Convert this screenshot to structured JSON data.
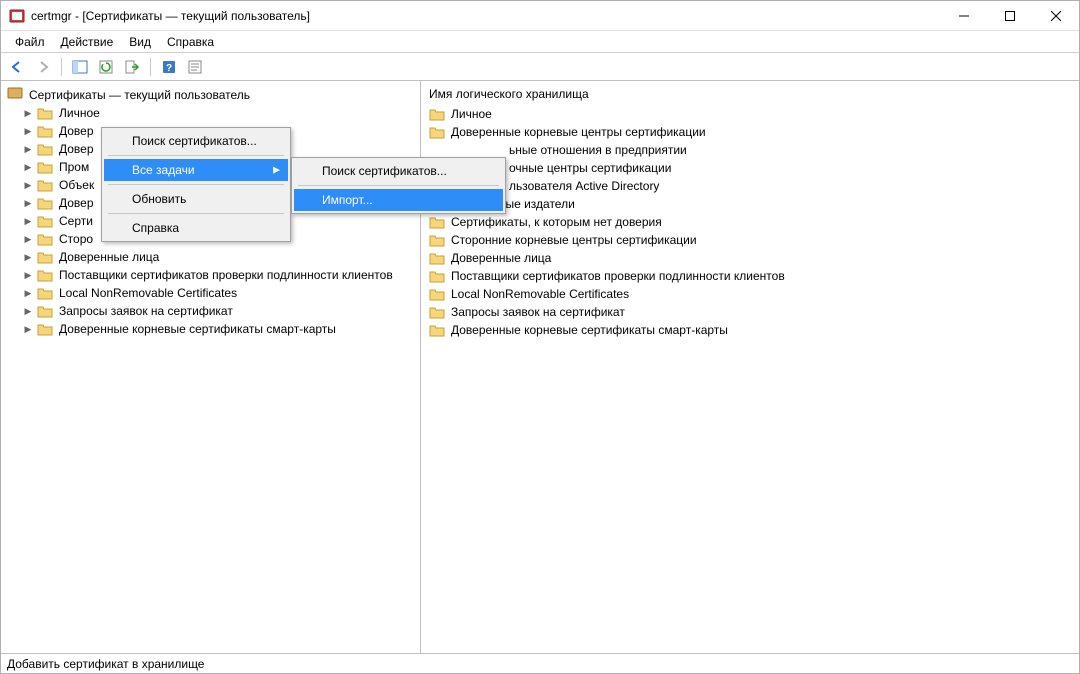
{
  "window": {
    "title": "certmgr - [Сертификаты — текущий пользователь]"
  },
  "menubar": [
    "Файл",
    "Действие",
    "Вид",
    "Справка"
  ],
  "tree": {
    "root": "Сертификаты — текущий пользователь",
    "items": [
      "Личное",
      "Доверенные корневые центры сертификации",
      "Доверительные отношения в предприятии",
      "Промежуточные центры сертификации",
      "Объект пользователя Active Directory",
      "Доверенные издатели",
      "Сертификаты, к которым нет доверия",
      "Сторонние корневые центры сертификации",
      "Доверенные лица",
      "Поставщики сертификатов проверки подлинности клиентов",
      "Local NonRemovable Certificates",
      "Запросы заявок на сертификат",
      "Доверенные корневые сертификаты смарт-карты"
    ],
    "partial": {
      "1": "Довер",
      "2": "Довер",
      "3": "Пром",
      "4": "Объек",
      "5": "Довер",
      "6": "Серти",
      "7": "Сторо"
    }
  },
  "right": {
    "header": "Имя логического хранилища",
    "items": [
      "Личное",
      "Доверенные корневые центры сертификации",
      "Доверительные отношения в предприятии",
      "Промежуточные центры сертификации",
      "Объект пользователя Active Directory",
      "Доверенные издатели",
      "Сертификаты, к которым нет доверия",
      "Сторонние корневые центры сертификации",
      "Доверенные лица",
      "Поставщики сертификатов проверки подлинности клиентов",
      "Local NonRemovable Certificates",
      "Запросы заявок на сертификат",
      "Доверенные корневые сертификаты смарт-карты"
    ],
    "partial": {
      "2": "ьные отношения в предприятии",
      "3": "очные центры сертификации",
      "4": "льзователя Active Directory"
    }
  },
  "context_menu": {
    "items": [
      "Поиск сертификатов...",
      "Все задачи",
      "Обновить",
      "Справка"
    ],
    "submenu": [
      "Поиск сертификатов...",
      "Импорт..."
    ]
  },
  "statusbar": "Добавить сертификат в хранилище"
}
